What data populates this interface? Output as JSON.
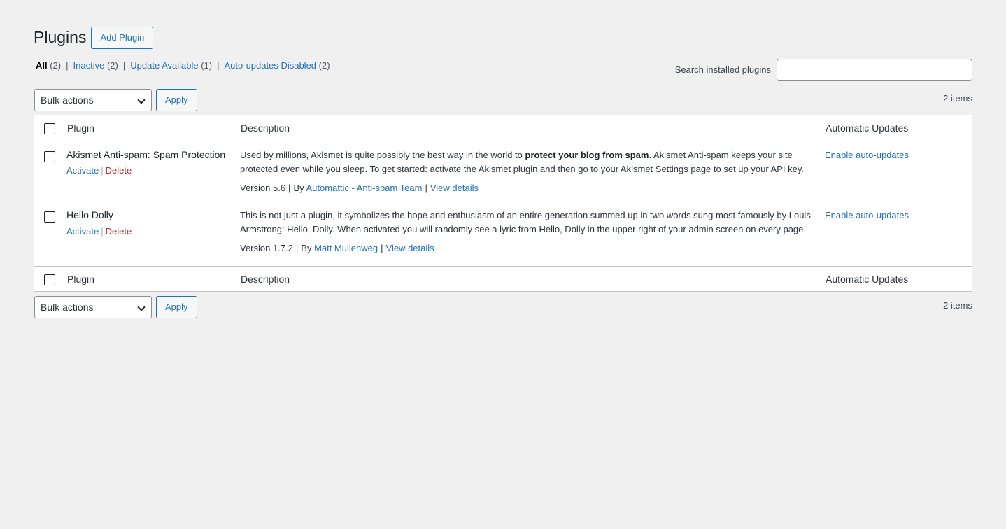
{
  "page": {
    "title": "Plugins",
    "add_button": "Add Plugin"
  },
  "filters": [
    {
      "label": "All",
      "count": "(2)"
    },
    {
      "label": "Inactive",
      "count": "(2)"
    },
    {
      "label": "Update Available",
      "count": "(1)"
    },
    {
      "label": "Auto-updates Disabled",
      "count": "(2)"
    }
  ],
  "search": {
    "label": "Search installed plugins",
    "value": "",
    "placeholder": ""
  },
  "tablenav": {
    "bulk_label": "Bulk actions",
    "apply_label": "Apply",
    "items_count": "2 items"
  },
  "columns": {
    "plugin": "Plugin",
    "description": "Description",
    "auto_updates": "Automatic Updates"
  },
  "plugins": [
    {
      "name": "Akismet Anti-spam: Spam Protection",
      "activate": "Activate",
      "delete": "Delete",
      "desc_pre": "Used by millions, Akismet is quite possibly the best way in the world to ",
      "desc_bold": "protect your blog from spam",
      "desc_post": ". Akismet Anti-spam keeps your site protected even while you sleep. To get started: activate the Akismet plugin and then go to your Akismet Settings page to set up your API key.",
      "version": "Version 5.6",
      "by": "By",
      "author": "Automattic - Anti-spam Team",
      "view_details": "View details",
      "auto_update_link": "Enable auto-updates"
    },
    {
      "name": "Hello Dolly",
      "activate": "Activate",
      "delete": "Delete",
      "desc_pre": "This is not just a plugin, it symbolizes the hope and enthusiasm of an entire generation summed up in two words sung most famously by Louis Armstrong: Hello, Dolly. When activated you will randomly see a lyric from Hello, Dolly in the upper right of your admin screen on every page.",
      "desc_bold": "",
      "desc_post": "",
      "version": "Version 1.7.2",
      "by": "By",
      "author": "Matt Mullenweg",
      "view_details": "View details",
      "auto_update_link": "Enable auto-updates"
    }
  ],
  "colors": {
    "background": "#f0f0f1",
    "link": "#2271b1",
    "delete": "#b32d2e",
    "border": "#c3c4c7",
    "text": "#1d2327"
  },
  "icons": {
    "select_arrow": "chevron-down-icon"
  }
}
